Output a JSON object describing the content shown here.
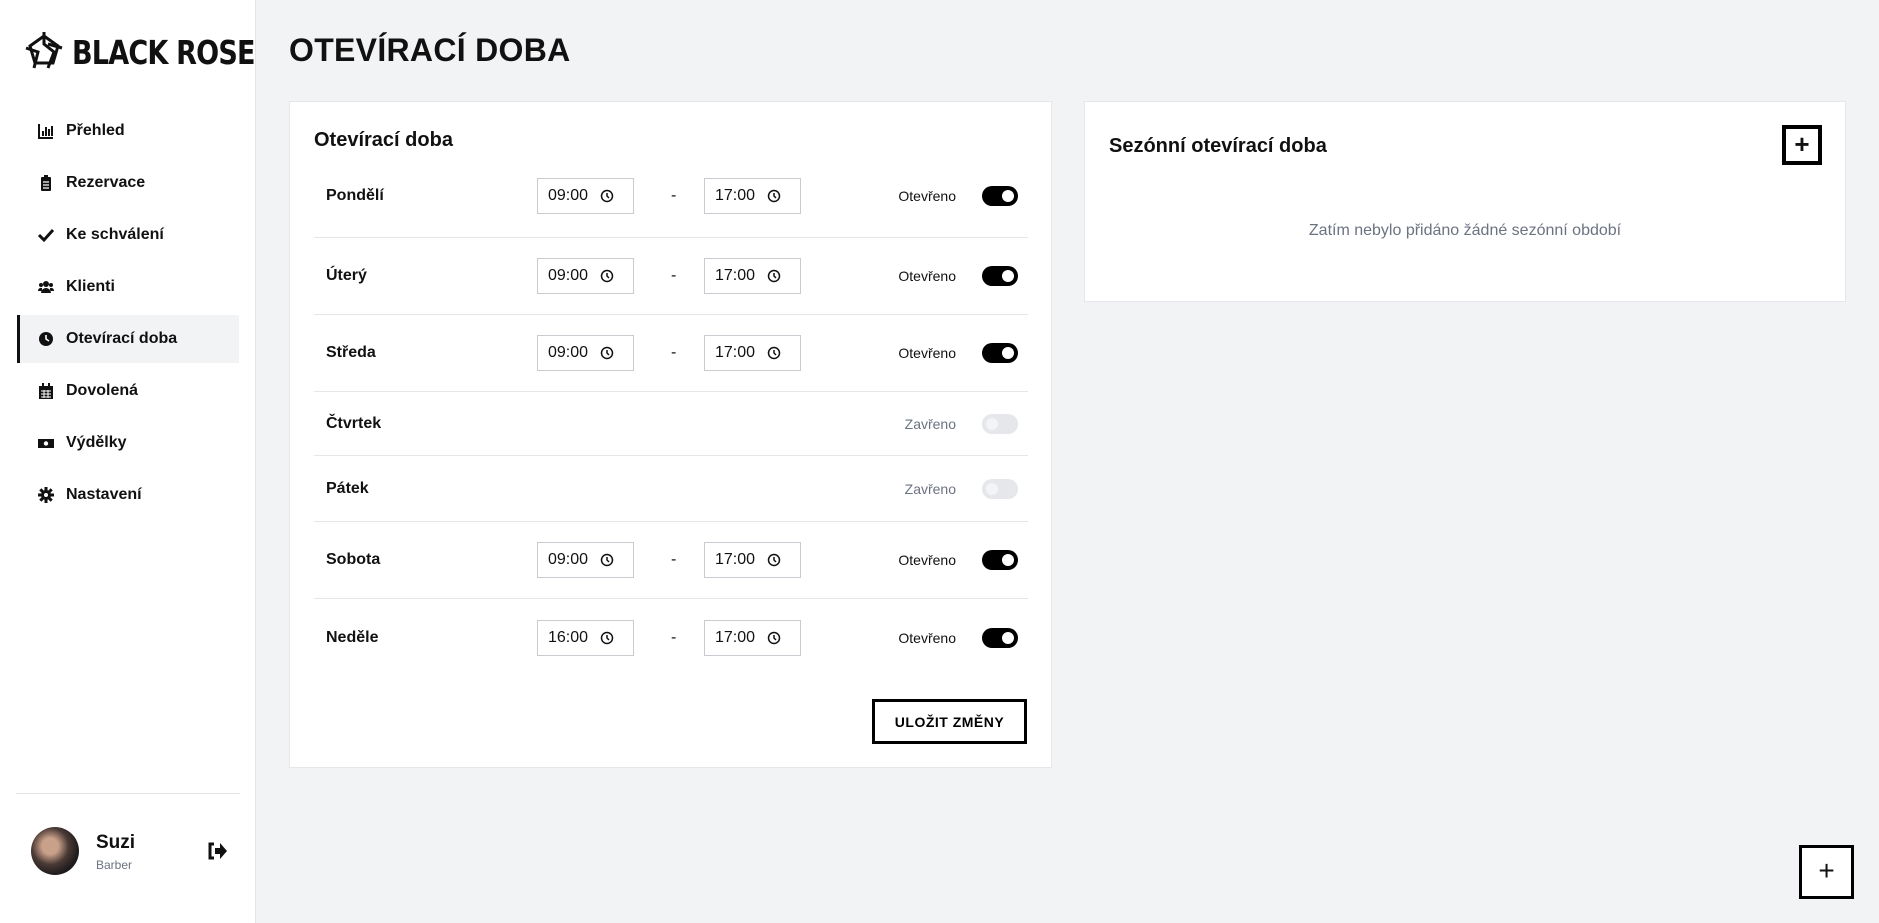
{
  "brand": {
    "name": "BLACK ROSE"
  },
  "sidebar": {
    "items": [
      {
        "label": "Přehled",
        "icon": "chart-icon"
      },
      {
        "label": "Rezervace",
        "icon": "clipboard-icon"
      },
      {
        "label": "Ke schválení",
        "icon": "check-icon"
      },
      {
        "label": "Klienti",
        "icon": "users-icon"
      },
      {
        "label": "Otevírací doba",
        "icon": "clock-icon",
        "active": true
      },
      {
        "label": "Dovolená",
        "icon": "calendar-icon"
      },
      {
        "label": "Výdělky",
        "icon": "money-icon"
      },
      {
        "label": "Nastavení",
        "icon": "gear-icon"
      }
    ]
  },
  "user": {
    "name": "Suzi",
    "role": "Barber"
  },
  "page": {
    "title": "OTEVÍRACÍ DOBA"
  },
  "hours": {
    "title": "Otevírací doba",
    "separator": "-",
    "days": [
      {
        "day": "Pondělí",
        "open": "09:00",
        "close": "17:00",
        "status": "Otevřeno",
        "is_open": true
      },
      {
        "day": "Úterý",
        "open": "09:00",
        "close": "17:00",
        "status": "Otevřeno",
        "is_open": true
      },
      {
        "day": "Středa",
        "open": "09:00",
        "close": "17:00",
        "status": "Otevřeno",
        "is_open": true
      },
      {
        "day": "Čtvrtek",
        "status": "Zavřeno",
        "is_open": false
      },
      {
        "day": "Pátek",
        "status": "Zavřeno",
        "is_open": false
      },
      {
        "day": "Sobota",
        "open": "09:00",
        "close": "17:00",
        "status": "Otevřeno",
        "is_open": true
      },
      {
        "day": "Neděle",
        "open": "16:00",
        "close": "17:00",
        "status": "Otevřeno",
        "is_open": true
      }
    ],
    "save_label": "ULOŽIT ZMĚNY"
  },
  "seasonal": {
    "title": "Sezónní otevírací doba",
    "add_label": "+",
    "empty": "Zatím nebylo přidáno žádné sezónní období"
  },
  "fab": {
    "label": "+"
  }
}
